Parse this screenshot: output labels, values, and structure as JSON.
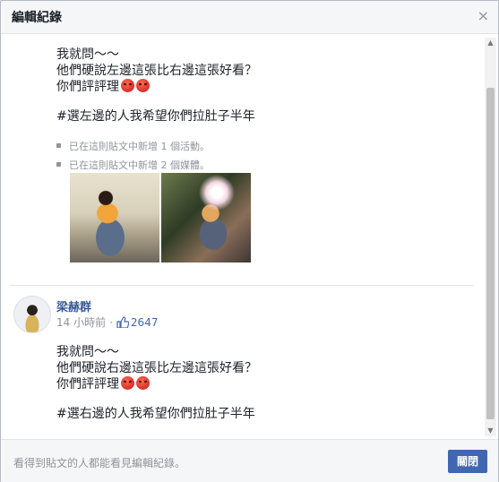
{
  "dialog": {
    "title": "編輯紀錄",
    "close_glyph": "×"
  },
  "version_top": {
    "lines": [
      "我就問～～",
      "他們硬說左邊這張比右邊這張好看？",
      "你們評評理"
    ],
    "hashtag": "#選左邊的人我希望你們拉肚子半年",
    "activities": [
      "已在這則貼文中新增 1 個活動。",
      "已在這則貼文中新增 2 個媒體。"
    ]
  },
  "version_bottom": {
    "author": "梁赫群",
    "time": "14 小時前",
    "separator": "·",
    "likes": "2647",
    "lines": [
      "我就問～～",
      "他們硬說右邊這張比左邊這張好看？",
      "你們評評理"
    ],
    "hashtag": "#選右邊的人我希望你們拉肚子半年"
  },
  "footer": {
    "note": "看得到貼文的人都能看見編輯紀錄。",
    "close_label": "關閉"
  },
  "colors": {
    "link": "#365899",
    "button": "#4267b2",
    "muted": "#90949c"
  }
}
